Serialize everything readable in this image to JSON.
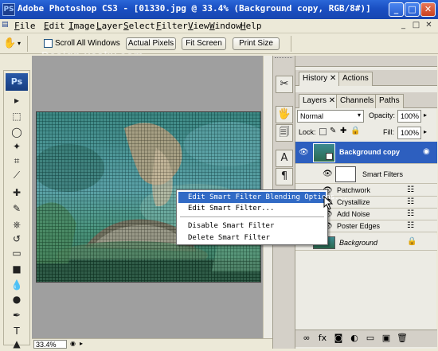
{
  "window": {
    "title": "Adobe Photoshop CS3 - [01330.jpg @ 33.4% (Background copy, RGB/8#)]",
    "minimize": "_",
    "maximize": "□",
    "close": "✕",
    "app_logo": "PS"
  },
  "menu": {
    "items": [
      {
        "key": "F",
        "rest": "ile"
      },
      {
        "key": "E",
        "rest": "dit"
      },
      {
        "key": "I",
        "rest": "mage"
      },
      {
        "key": "L",
        "rest": "ayer"
      },
      {
        "key": "S",
        "rest": "elect"
      },
      {
        "key": "F",
        "rest": "ilter"
      },
      {
        "key": "V",
        "rest": "iew"
      },
      {
        "key": "W",
        "rest": "indow"
      },
      {
        "key": "H",
        "rest": "elp"
      }
    ],
    "doc_controls": [
      "_",
      "□",
      "✕"
    ]
  },
  "options": {
    "scroll_all_windows": "Scroll All Windows",
    "actual_pixels": "Actual Pixels",
    "fit_screen": "Fit Screen",
    "print_size": "Print Size"
  },
  "watermark": "Design.yesky.com",
  "toolbox": {
    "badge": "Ps",
    "tools": [
      "move-tool-icon",
      "marquee-tool-icon",
      "lasso-tool-icon",
      "magic-wand-icon",
      "crop-tool-icon",
      "slice-tool-icon",
      "healing-brush-icon",
      "brush-tool-icon",
      "clone-stamp-icon",
      "history-brush-icon",
      "eraser-tool-icon",
      "gradient-tool-icon",
      "blur-tool-icon",
      "dodge-tool-icon",
      "pen-tool-icon",
      "type-tool-icon",
      "path-select-icon"
    ],
    "glyphs": [
      "▸",
      "⬚",
      "◯",
      "✦",
      "⌗",
      "⟋",
      "✚",
      "✎",
      "⎈",
      "↺",
      "▭",
      "■",
      "💧",
      "●",
      "✒",
      "T",
      "▲"
    ]
  },
  "status": {
    "zoom": "33.4%"
  },
  "dock": {
    "icons": [
      "✂",
      "🖐",
      "🗐",
      "A",
      "¶"
    ]
  },
  "panels": {
    "top_tabs": [
      "History",
      "Actions"
    ],
    "layer_tabs": [
      "Layers",
      "Channels",
      "Paths"
    ],
    "blend_mode": "Normal",
    "opacity_label": "Opacity:",
    "opacity_value": "100%",
    "lock_label": "Lock:",
    "fill_label": "Fill:",
    "fill_value": "100%",
    "layers": {
      "background_copy": "Background copy",
      "smart_filters": "Smart Filters",
      "filters": [
        "Patchwork",
        "Crystallize",
        "Add Noise",
        "Poster Edges"
      ],
      "background": "Background"
    },
    "bottom_icons": [
      "link-icon",
      "fx-icon",
      "mask-icon",
      "adjustment-icon",
      "group-icon",
      "new-layer-icon",
      "trash-icon"
    ],
    "bottom_glyphs": [
      "∞",
      "fx",
      "◙",
      "◐",
      "▭",
      "▣",
      "🗑"
    ]
  },
  "context_menu": {
    "items": [
      "Edit Smart Filter Blending Options...",
      "Edit Smart Filter...",
      "Disable Smart Filter",
      "Delete Smart Filter"
    ],
    "highlighted_index": 0
  },
  "colors": {
    "titlebar": "#1a4fc2",
    "selection": "#316ac5",
    "layer_selected": "#2d5fbf"
  }
}
